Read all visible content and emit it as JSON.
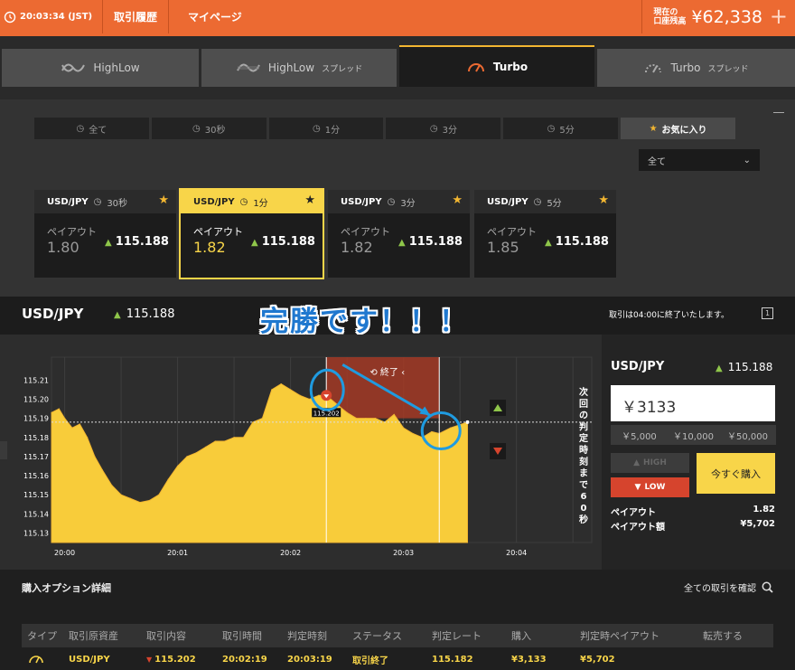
{
  "topbar": {
    "time": "20:03:34 (JST)",
    "history": "取引履歴",
    "mypage": "マイページ",
    "balance_label_1": "現在の",
    "balance_label_2": "口座残高",
    "balance": "¥62,338",
    "plus": "+"
  },
  "product_tabs": [
    {
      "label": "HighLow",
      "sub": ""
    },
    {
      "label": "HighLow",
      "sub": "スプレッド"
    },
    {
      "label": "Turbo",
      "sub": ""
    },
    {
      "label": "Turbo",
      "sub": "スプレッド"
    }
  ],
  "filters": [
    "全て",
    "30秒",
    "1分",
    "3分",
    "5分",
    "お気に入り"
  ],
  "select_value": "全て",
  "cards": [
    {
      "pair": "USD/JPY",
      "time": "30秒",
      "payout_label": "ペイアウト",
      "payout": "1.80",
      "rate": "115.188"
    },
    {
      "pair": "USD/JPY",
      "time": "1分",
      "payout_label": "ペイアウト",
      "payout": "1.82",
      "rate": "115.188"
    },
    {
      "pair": "USD/JPY",
      "time": "3分",
      "payout_label": "ペイアウト",
      "payout": "1.82",
      "rate": "115.188"
    },
    {
      "pair": "USD/JPY",
      "time": "5分",
      "payout_label": "ペイアウト",
      "payout": "1.85",
      "rate": "115.188"
    }
  ],
  "header": {
    "pair": "USD/JPY",
    "rate": "115.188",
    "caption": "完勝です！！！",
    "note": "取引は04:00に終了いたします。"
  },
  "chart_data": {
    "type": "area",
    "y_ticks": [
      "115.21",
      "115.20",
      "115.19",
      "115.18",
      "115.17",
      "115.16",
      "115.15",
      "115.14",
      "115.13"
    ],
    "x_ticks": [
      "20:00",
      "20:01",
      "20:02",
      "20:03",
      "20:04"
    ],
    "ylim": [
      115.125,
      115.222
    ],
    "end_label": "終了",
    "entry_rate_label": "115.202",
    "countdown": "次回の判定時刻まで60秒",
    "series": [
      {
        "x": "19:59:53",
        "y": 115.193
      },
      {
        "x": "19:59:57",
        "y": 115.195
      },
      {
        "x": "20:00:00",
        "y": 115.19
      },
      {
        "x": "20:00:04",
        "y": 115.185
      },
      {
        "x": "20:00:08",
        "y": 115.187
      },
      {
        "x": "20:00:12",
        "y": 115.18
      },
      {
        "x": "20:00:16",
        "y": 115.17
      },
      {
        "x": "20:00:20",
        "y": 115.163
      },
      {
        "x": "20:00:25",
        "y": 115.155
      },
      {
        "x": "20:00:30",
        "y": 115.15
      },
      {
        "x": "20:00:35",
        "y": 115.148
      },
      {
        "x": "20:00:40",
        "y": 115.146
      },
      {
        "x": "20:00:45",
        "y": 115.147
      },
      {
        "x": "20:00:50",
        "y": 115.15
      },
      {
        "x": "20:00:55",
        "y": 115.158
      },
      {
        "x": "20:01:00",
        "y": 115.165
      },
      {
        "x": "20:01:05",
        "y": 115.17
      },
      {
        "x": "20:01:10",
        "y": 115.172
      },
      {
        "x": "20:01:15",
        "y": 115.175
      },
      {
        "x": "20:01:20",
        "y": 115.178
      },
      {
        "x": "20:01:25",
        "y": 115.178
      },
      {
        "x": "20:01:30",
        "y": 115.18
      },
      {
        "x": "20:01:35",
        "y": 115.18
      },
      {
        "x": "20:01:40",
        "y": 115.188
      },
      {
        "x": "20:01:45",
        "y": 115.19
      },
      {
        "x": "20:01:50",
        "y": 115.205
      },
      {
        "x": "20:01:55",
        "y": 115.208
      },
      {
        "x": "20:02:00",
        "y": 115.205
      },
      {
        "x": "20:02:05",
        "y": 115.202
      },
      {
        "x": "20:02:10",
        "y": 115.2
      },
      {
        "x": "20:02:15",
        "y": 115.202
      },
      {
        "x": "20:02:19",
        "y": 115.202
      },
      {
        "x": "20:02:25",
        "y": 115.197
      },
      {
        "x": "20:02:30",
        "y": 115.193
      },
      {
        "x": "20:02:35",
        "y": 115.19
      },
      {
        "x": "20:02:40",
        "y": 115.19
      },
      {
        "x": "20:02:45",
        "y": 115.19
      },
      {
        "x": "20:02:50",
        "y": 115.188
      },
      {
        "x": "20:02:55",
        "y": 115.192
      },
      {
        "x": "20:03:00",
        "y": 115.185
      },
      {
        "x": "20:03:05",
        "y": 115.182
      },
      {
        "x": "20:03:10",
        "y": 115.18
      },
      {
        "x": "20:03:15",
        "y": 115.183
      },
      {
        "x": "20:03:19",
        "y": 115.182
      },
      {
        "x": "20:03:25",
        "y": 115.185
      },
      {
        "x": "20:03:34",
        "y": 115.188
      }
    ]
  },
  "side": {
    "pair": "USD/JPY",
    "rate": "115.188",
    "amount": "￥3133",
    "quick": [
      "￥5,000",
      "￥10,000",
      "￥50,000"
    ],
    "high": "HIGH",
    "low": "LOW",
    "buy": "今すぐ購入",
    "payout_label": "ペイアウト",
    "payout": "1.82",
    "payout_amount_label": "ペイアウト額",
    "payout_amount": "¥5,702"
  },
  "bottom": {
    "title": "購入オプション詳細",
    "link": "全ての取引を確認",
    "columns": [
      "タイプ",
      "取引原資産",
      "取引内容",
      "取引時間",
      "判定時刻",
      "ステータス",
      "判定レート",
      "購入",
      "判定時ペイアウト",
      "転売する"
    ],
    "row": [
      "",
      "USD/JPY",
      "115.202",
      "20:02:19",
      "20:03:19",
      "取引終了",
      "115.182",
      "¥3,133",
      "¥5,702",
      ""
    ]
  },
  "colors": {
    "accent": "#ec6a32",
    "yellow": "#f8d549",
    "green": "#8fc64a",
    "red": "#d6442d",
    "annotation": "#1f78cf"
  }
}
